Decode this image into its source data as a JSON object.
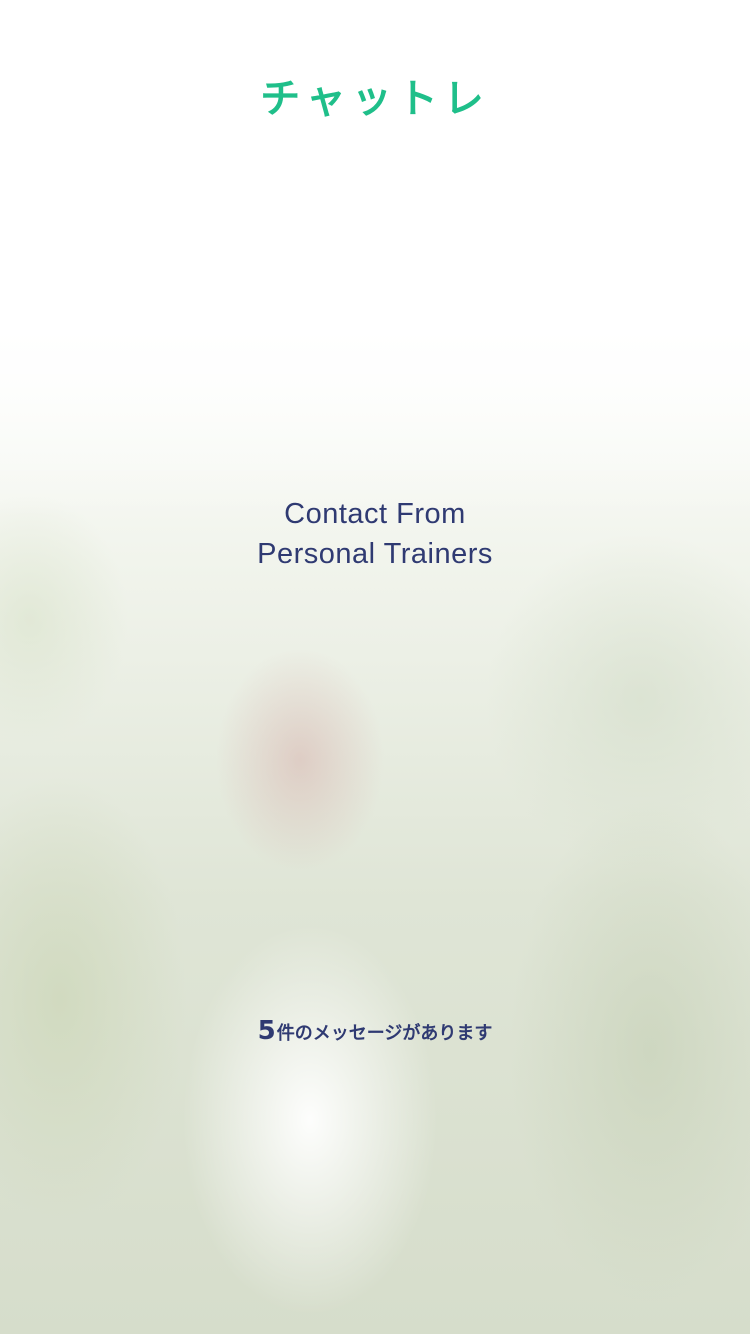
{
  "app": {
    "logo_text": "チャットレ",
    "brand_color": "#1fbf8a"
  },
  "headline": {
    "line1": "Contact From",
    "line2": "Personal Trainers",
    "color": "#2f3a72"
  },
  "notice": {
    "count": "5",
    "text": "件のメッセージがあります"
  }
}
